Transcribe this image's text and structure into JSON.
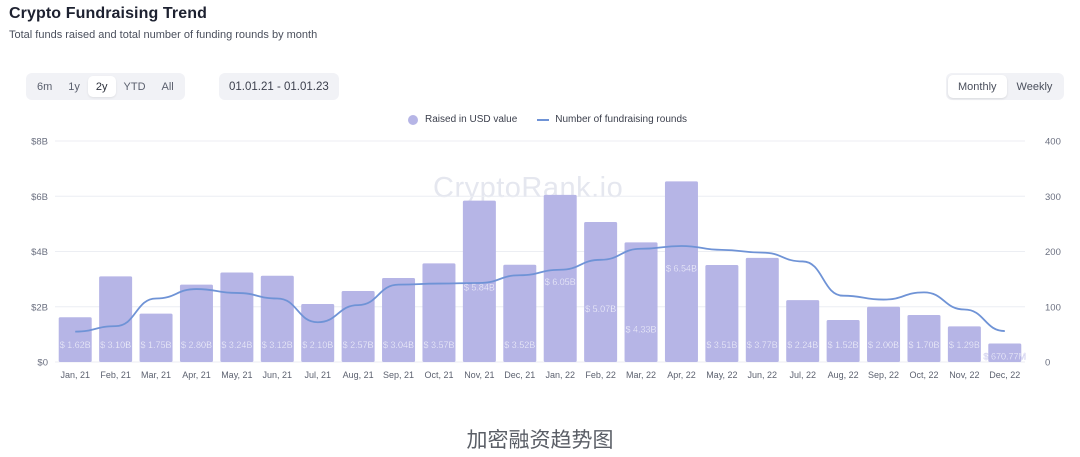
{
  "header": {
    "title": "Crypto Fundraising Trend",
    "subtitle": "Total funds raised and total number of funding rounds by month"
  },
  "controls": {
    "ranges": [
      "6m",
      "1y",
      "2y",
      "YTD",
      "All"
    ],
    "active_range": "2y",
    "date_range": "01.01.21 - 01.01.23",
    "periods": [
      "Monthly",
      "Weekly"
    ],
    "active_period": "Monthly"
  },
  "watermark": "CryptoRank.io",
  "caption": "加密融资趋势图",
  "colors": {
    "bar": "#b6b5e6",
    "line": "#6f93d6",
    "grid": "#eceef3"
  },
  "chart_data": {
    "type": "bar",
    "categories": [
      "Jan, 21",
      "Feb, 21",
      "Mar, 21",
      "Apr, 21",
      "May, 21",
      "Jun, 21",
      "Jul, 21",
      "Aug, 21",
      "Sep, 21",
      "Oct, 21",
      "Nov, 21",
      "Dec, 21",
      "Jan, 22",
      "Feb, 22",
      "Mar, 22",
      "Apr, 22",
      "May, 22",
      "Jun, 22",
      "Jul, 22",
      "Aug, 22",
      "Sep, 22",
      "Oct, 22",
      "Nov, 22",
      "Dec, 22"
    ],
    "series": [
      {
        "name": "Raised in USD value",
        "type": "bar",
        "axis": "left",
        "values": [
          1.62,
          3.1,
          1.75,
          2.8,
          3.24,
          3.12,
          2.1,
          2.57,
          3.04,
          3.57,
          5.84,
          3.52,
          6.05,
          5.07,
          4.33,
          6.54,
          3.51,
          3.77,
          2.24,
          1.52,
          2.0,
          1.7,
          1.29,
          0.67
        ],
        "labels": [
          "$ 1.62B",
          "$ 3.10B",
          "$ 1.75B",
          "$ 2.80B",
          "$ 3.24B",
          "$ 3.12B",
          "$ 2.10B",
          "$ 2.57B",
          "$ 3.04B",
          "$ 3.57B",
          "$ 5.84B",
          "$ 3.52B",
          "$ 6.05B",
          "$ 5.07B",
          "$ 4.33B",
          "$ 6.54B",
          "$ 3.51B",
          "$ 3.77B",
          "$ 2.24B",
          "$ 1.52B",
          "$ 2.00B",
          "$ 1.70B",
          "$ 1.29B",
          "$ 670.77M"
        ]
      },
      {
        "name": "Number of fundraising rounds",
        "type": "line",
        "axis": "right",
        "values": [
          55,
          65,
          115,
          132,
          125,
          115,
          72,
          103,
          140,
          142,
          143,
          157,
          167,
          185,
          205,
          210,
          203,
          198,
          182,
          120,
          113,
          126,
          95,
          56
        ]
      }
    ],
    "y_left": {
      "ticks": [
        "$0",
        "$2B",
        "$4B",
        "$6B",
        "$8B"
      ],
      "range": [
        0,
        8
      ]
    },
    "y_right": {
      "ticks": [
        "0",
        "100",
        "200",
        "300",
        "400"
      ],
      "range": [
        0,
        400
      ]
    },
    "grid": true,
    "legend": "top-center"
  }
}
